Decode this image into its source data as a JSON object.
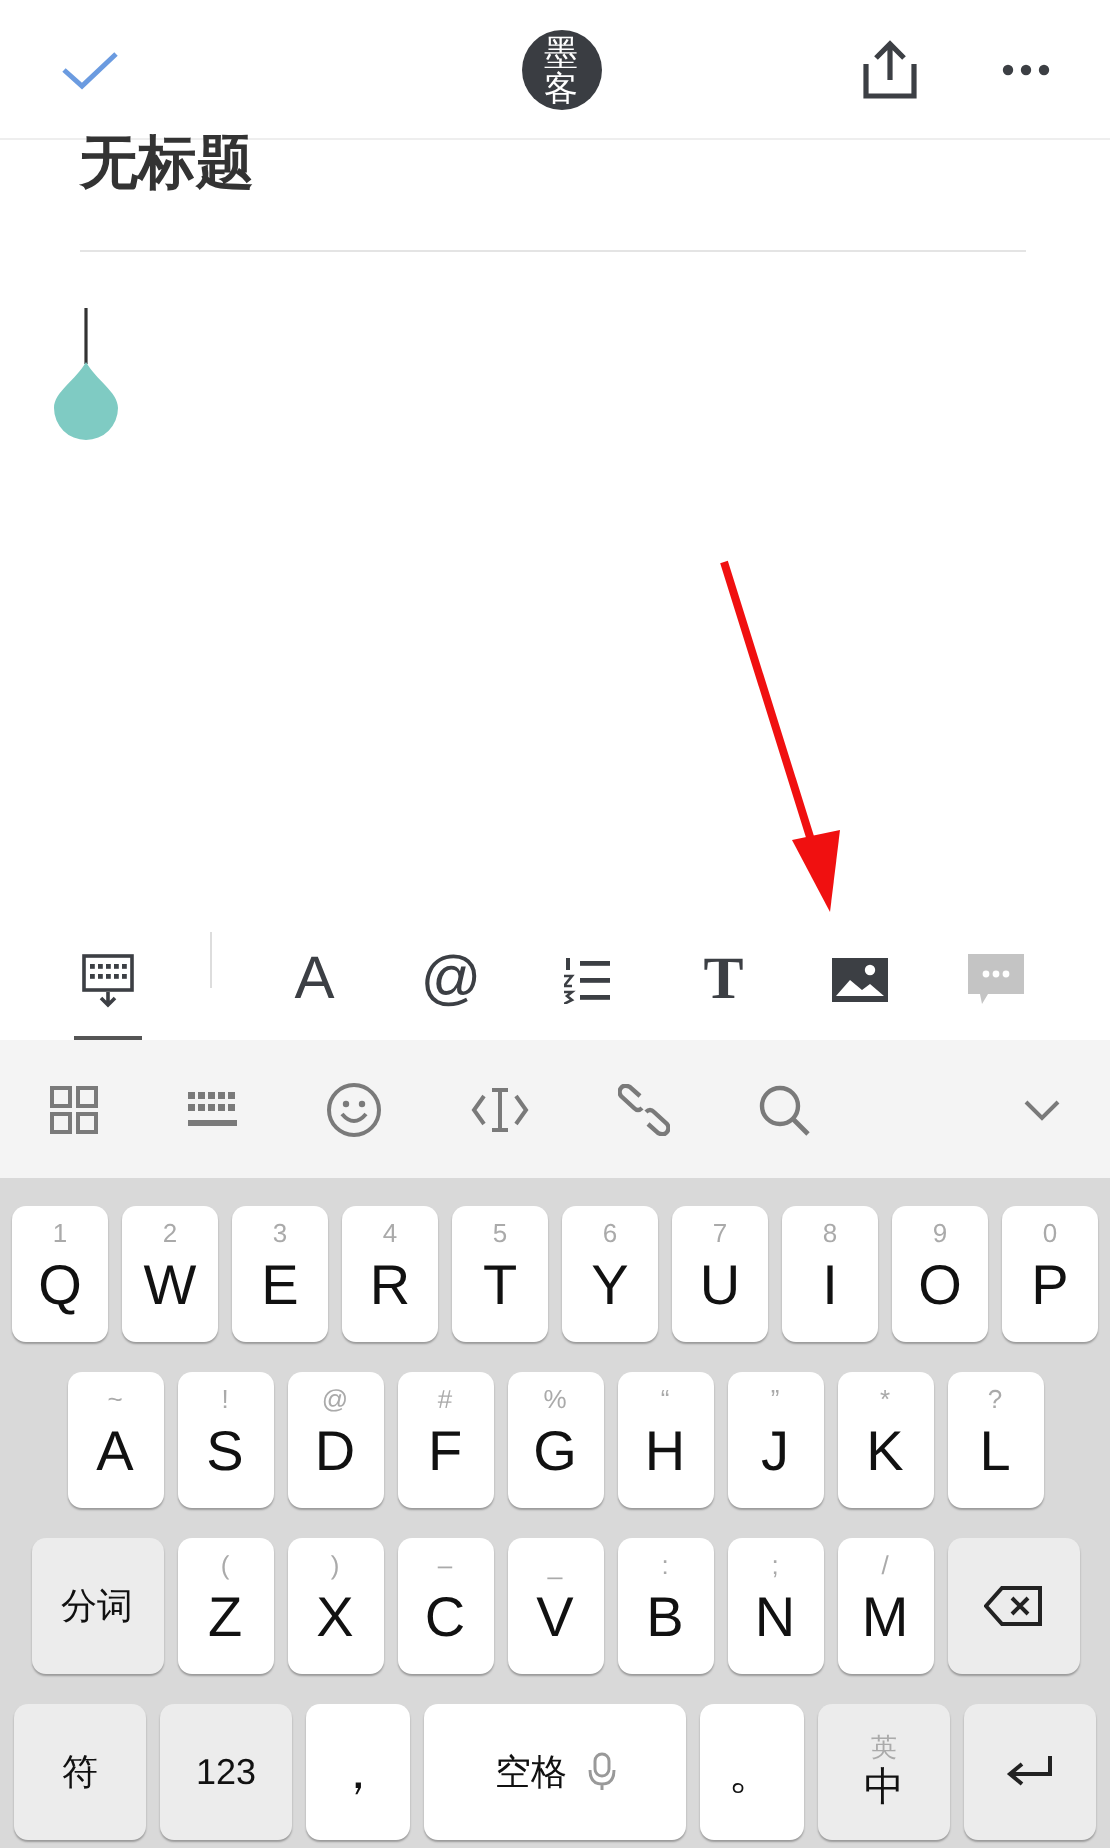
{
  "header": {
    "logo_text": "墨客"
  },
  "note": {
    "title": "无标题"
  },
  "format_toolbar": [
    {
      "kind": "keyboard",
      "selected": true,
      "disabled": false
    },
    {
      "kind": "glyph",
      "label": "A",
      "selected": false,
      "disabled": false
    },
    {
      "kind": "glyph",
      "label": "@",
      "selected": false,
      "disabled": false
    },
    {
      "kind": "list",
      "selected": false,
      "disabled": false
    },
    {
      "kind": "serif",
      "label": "T",
      "selected": false,
      "disabled": false
    },
    {
      "kind": "image",
      "selected": false,
      "disabled": false
    },
    {
      "kind": "comment",
      "selected": false,
      "disabled": true
    }
  ],
  "candidate_bar": [
    {
      "kind": "grid"
    },
    {
      "kind": "keyboard"
    },
    {
      "kind": "emoji"
    },
    {
      "kind": "cursor"
    },
    {
      "kind": "link"
    },
    {
      "kind": "search"
    },
    {
      "kind": "collapse"
    }
  ],
  "keyboard": {
    "rows": [
      {
        "keys": [
          {
            "kind": "letter",
            "label": "Q",
            "hint": "1"
          },
          {
            "kind": "letter",
            "label": "W",
            "hint": "2"
          },
          {
            "kind": "letter",
            "label": "E",
            "hint": "3"
          },
          {
            "kind": "letter",
            "label": "R",
            "hint": "4"
          },
          {
            "kind": "letter",
            "label": "T",
            "hint": "5"
          },
          {
            "kind": "letter",
            "label": "Y",
            "hint": "6"
          },
          {
            "kind": "letter",
            "label": "U",
            "hint": "7"
          },
          {
            "kind": "letter",
            "label": "I",
            "hint": "8"
          },
          {
            "kind": "letter",
            "label": "O",
            "hint": "9"
          },
          {
            "kind": "letter",
            "label": "P",
            "hint": "0"
          }
        ]
      },
      {
        "keys": [
          {
            "kind": "letter",
            "label": "A",
            "hint": "~"
          },
          {
            "kind": "letter",
            "label": "S",
            "hint": "!"
          },
          {
            "kind": "letter",
            "label": "D",
            "hint": "@"
          },
          {
            "kind": "letter",
            "label": "F",
            "hint": "#"
          },
          {
            "kind": "letter",
            "label": "G",
            "hint": "%"
          },
          {
            "kind": "letter",
            "label": "H",
            "hint": "“"
          },
          {
            "kind": "letter",
            "label": "J",
            "hint": "”"
          },
          {
            "kind": "letter",
            "label": "K",
            "hint": "*"
          },
          {
            "kind": "letter",
            "label": "L",
            "hint": "?"
          }
        ]
      },
      {
        "keys": [
          {
            "kind": "function",
            "label": "分词"
          },
          {
            "kind": "letter",
            "label": "Z",
            "hint": "("
          },
          {
            "kind": "letter",
            "label": "X",
            "hint": ")"
          },
          {
            "kind": "letter",
            "label": "C",
            "hint": "–"
          },
          {
            "kind": "letter",
            "label": "V",
            "hint": "_"
          },
          {
            "kind": "letter",
            "label": "B",
            "hint": ":"
          },
          {
            "kind": "letter",
            "label": "N",
            "hint": ";"
          },
          {
            "kind": "letter",
            "label": "M",
            "hint": "/"
          },
          {
            "kind": "backspace"
          }
        ]
      },
      {
        "keys": [
          {
            "kind": "function",
            "label": "符"
          },
          {
            "kind": "function",
            "label": "123"
          },
          {
            "kind": "punct",
            "label": "，"
          },
          {
            "kind": "space",
            "label": "空格"
          },
          {
            "kind": "punct",
            "label": "。"
          },
          {
            "kind": "language",
            "label": "中",
            "hint": "英"
          },
          {
            "kind": "enter"
          }
        ]
      }
    ]
  }
}
